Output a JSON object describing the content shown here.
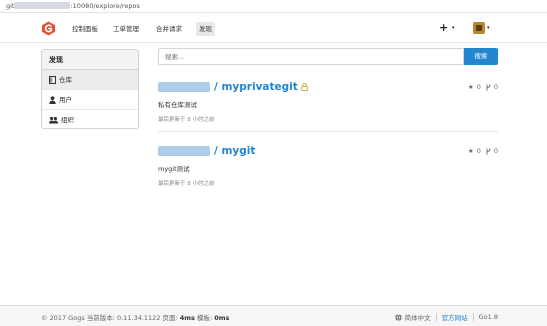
{
  "browser": {
    "url_prefix": "git",
    "url_suffix": ":10080/explore/repos"
  },
  "header": {
    "nav": [
      "控制面板",
      "工单管理",
      "合并请求",
      "发现"
    ],
    "plus": "+",
    "caret": "▾",
    "colors": {
      "logo": "#e0503b",
      "accent": "#2185d0"
    }
  },
  "menu": {
    "title": "发现",
    "items": [
      {
        "label": "仓库",
        "icon": "repo-icon",
        "active": true
      },
      {
        "label": "用户",
        "icon": "user-icon",
        "active": false
      },
      {
        "label": "组织",
        "icon": "organization-icon",
        "active": false
      }
    ]
  },
  "search": {
    "placeholder": "搜索...",
    "button": "搜索"
  },
  "repos": [
    {
      "name_suffix": "/ myprivategit",
      "private": true,
      "description": "私有仓库测试",
      "updated": "最后更新于 8 小时之前",
      "stars": "0",
      "forks": "0"
    },
    {
      "name_suffix": "/ mygit",
      "private": false,
      "description": "mygit测试",
      "updated": "最后更新于 8 小时之前",
      "stars": "0",
      "forks": "0"
    }
  ],
  "footer": {
    "copyright": "© 2017 Gogs 当前版本: 0.11.34.1122 页面: ",
    "page_time": "4ms",
    "tpl_label": " 模板: ",
    "tpl_time": "0ms",
    "language": "简体中文",
    "website": "官方网站",
    "go_version": "Go1.8"
  }
}
